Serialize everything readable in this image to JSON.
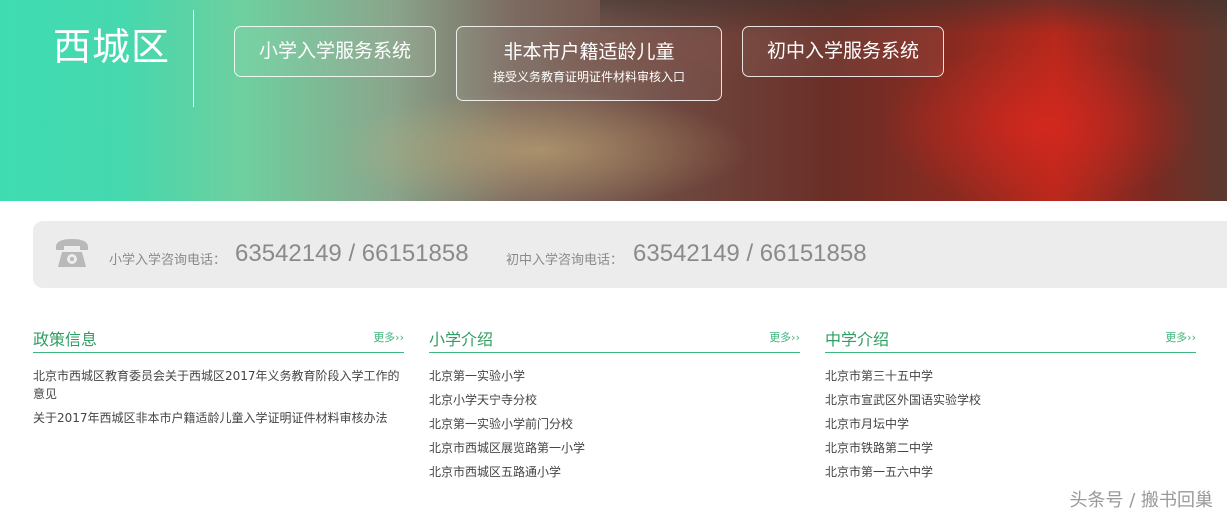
{
  "banner": {
    "district": "西城区",
    "primary_button": "小学入学服务系统",
    "nonlocal_button": {
      "title": "非本市户籍适龄儿童",
      "subtitle": "接受义务教育证明证件材料审核入口"
    },
    "middle_button": "初中入学服务系统"
  },
  "phone_bar": {
    "icon": "telephone-icon",
    "primary_label": "小学入学咨询电话：",
    "primary_number": "63542149 / 66151858",
    "middle_label": "初中入学咨询电话：",
    "middle_number": "63542149 / 66151858"
  },
  "columns": [
    {
      "title": "政策信息",
      "more": "更多››",
      "items": [
        "北京市西城区教育委员会关于西城区2017年义务教育阶段入学工作的意见",
        "关于2017年西城区非本市户籍适龄儿童入学证明证件材料审核办法"
      ]
    },
    {
      "title": "小学介绍",
      "more": "更多››",
      "items": [
        "北京第一实验小学",
        "北京小学天宁寺分校",
        "北京第一实验小学前门分校",
        "北京市西城区展览路第一小学",
        "北京市西城区五路通小学"
      ]
    },
    {
      "title": "中学介绍",
      "more": "更多››",
      "items": [
        "北京市第三十五中学",
        "北京市宣武区外国语实验学校",
        "北京市月坛中学",
        "北京市铁路第二中学",
        "北京市第一五六中学"
      ]
    }
  ],
  "watermark": "头条号 / 搬书回巢",
  "colors": {
    "accent_green": "#3fb67b",
    "title_green": "#2f9e62",
    "phone_bar_bg": "#ececec"
  }
}
